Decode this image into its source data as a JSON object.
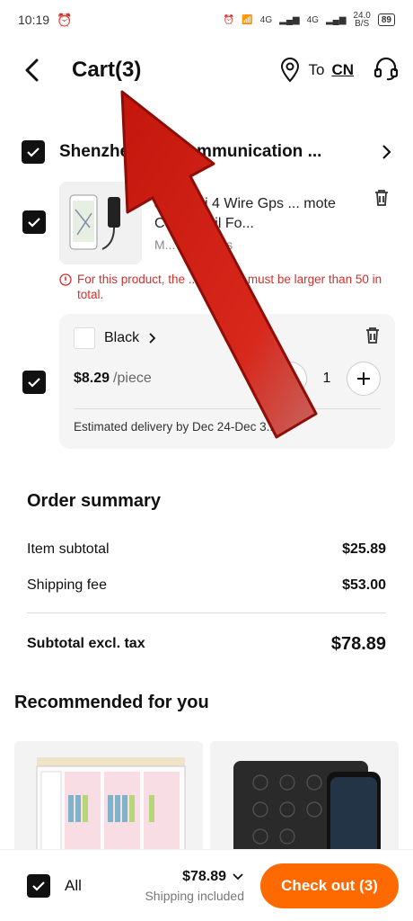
{
  "status": {
    "time": "10:19",
    "net1": "4G",
    "net2": "4G",
    "speed": "24.0",
    "speed_unit": "B/S",
    "battery": "89"
  },
  "header": {
    "title": "Cart(3)",
    "to_label": "To",
    "country": "CN"
  },
  "seller": {
    "name": "Shenzhen... g Communication ..."
  },
  "product": {
    "title": "J14 Mini 4 Wire Gps ... mote Cut Off Oil Fo...",
    "moq": "M... 50 pieces"
  },
  "warning": {
    "text": "For this product, the ... quantity must be larger than 50 in total."
  },
  "variant": {
    "color": "Black",
    "price": "$8.29",
    "unit": "/piece",
    "quantity": "1",
    "delivery": "Estimated delivery by Dec 24-Dec 3..."
  },
  "summary": {
    "title": "Order summary",
    "rows": [
      {
        "label": "Item subtotal",
        "value": "$25.89"
      },
      {
        "label": "Shipping fee",
        "value": "$53.00"
      }
    ],
    "total_label": "Subtotal excl. tax",
    "total_value": "$78.89"
  },
  "recommended": {
    "title": "Recommended for you"
  },
  "bottom": {
    "all_label": "All",
    "amount": "$78.89",
    "shipping": "Shipping included",
    "checkout": "Check out (3)"
  },
  "colors": {
    "accent": "#ff6a00",
    "warning": "#d0312d",
    "arrow": "#cc1a10"
  }
}
